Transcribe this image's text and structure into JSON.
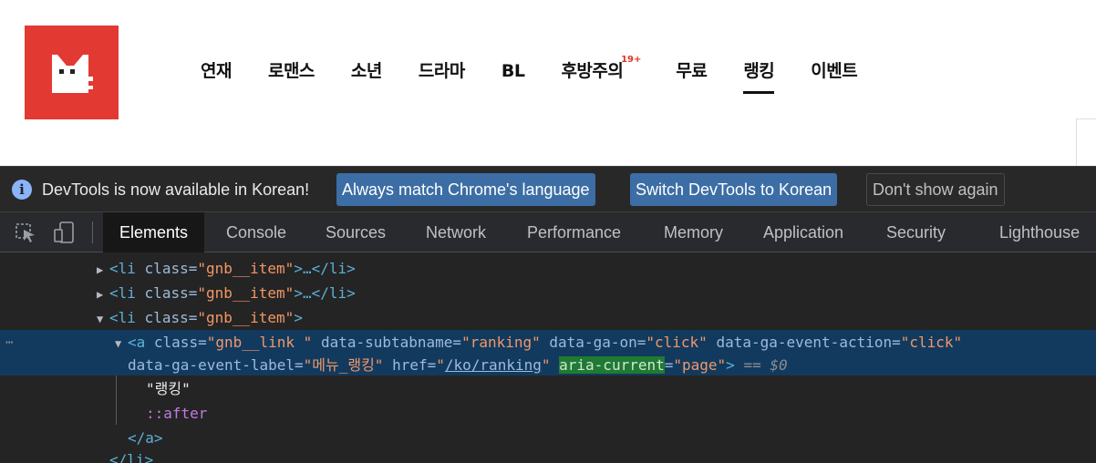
{
  "site": {
    "logo_label": "",
    "nav": [
      {
        "label": "연재"
      },
      {
        "label": "로맨스"
      },
      {
        "label": "소년"
      },
      {
        "label": "드라마"
      },
      {
        "label": "BL"
      },
      {
        "label": "후방주의",
        "badge": "19+"
      },
      {
        "label": "무료"
      },
      {
        "label": "랭킹",
        "active": true
      },
      {
        "label": "이벤트"
      }
    ],
    "brand_color": "#e23a32",
    "badge_color": "#e2332a"
  },
  "devtools": {
    "infobar": {
      "icon": "info-icon",
      "message": "DevTools is now available in Korean!",
      "btn_always": "Always match Chrome's language",
      "btn_switch": "Switch DevTools to Korean",
      "btn_dismiss": "Don't show again"
    },
    "toolbar": {
      "inspect_icon": "inspect-element-icon",
      "device_icon": "device-toggle-icon"
    },
    "tabs": [
      {
        "label": "Elements",
        "active": true
      },
      {
        "label": "Console"
      },
      {
        "label": "Sources"
      },
      {
        "label": "Network"
      },
      {
        "label": "Performance"
      },
      {
        "label": "Memory"
      },
      {
        "label": "Application"
      },
      {
        "label": "Security"
      },
      {
        "label": "Lighthouse"
      }
    ],
    "dom": {
      "li_tag_open": "<li",
      "li_tag_close_collapsed": ">…</li>",
      "li_tag_close_open": ">",
      "attr_class": "class=",
      "val_gnb_item": "\"gnb__item\"",
      "a_tag_open": "<a",
      "val_gnb_link": "\"gnb__link \"",
      "attr_subtab": "data-subtabname=",
      "val_subtab": "\"ranking\"",
      "attr_ga_on": "data-ga-on=",
      "val_ga_on": "\"click\"",
      "attr_ga_action": "data-ga-event-action=",
      "val_ga_action": "\"click\"",
      "attr_ga_label": "data-ga-event-label=",
      "val_ga_label": "\"메뉴_랭킹\"",
      "attr_href": "href=",
      "quote": "\"",
      "val_href": "/ko/ranking",
      "attr_aria": "aria-current",
      "attr_eq": "=",
      "val_aria": "\"page\"",
      "close_gt": ">",
      "selected_marker": "== $0",
      "text_node": "\"랭킹\"",
      "pseudo_after": "::after",
      "a_close": "</a>",
      "li_close": "</li>",
      "row_dots": "⋯"
    },
    "colors": {
      "selected_row": "#123a5e",
      "highlight": "#1f7a33",
      "primary_button": "#3c6ea5"
    }
  }
}
